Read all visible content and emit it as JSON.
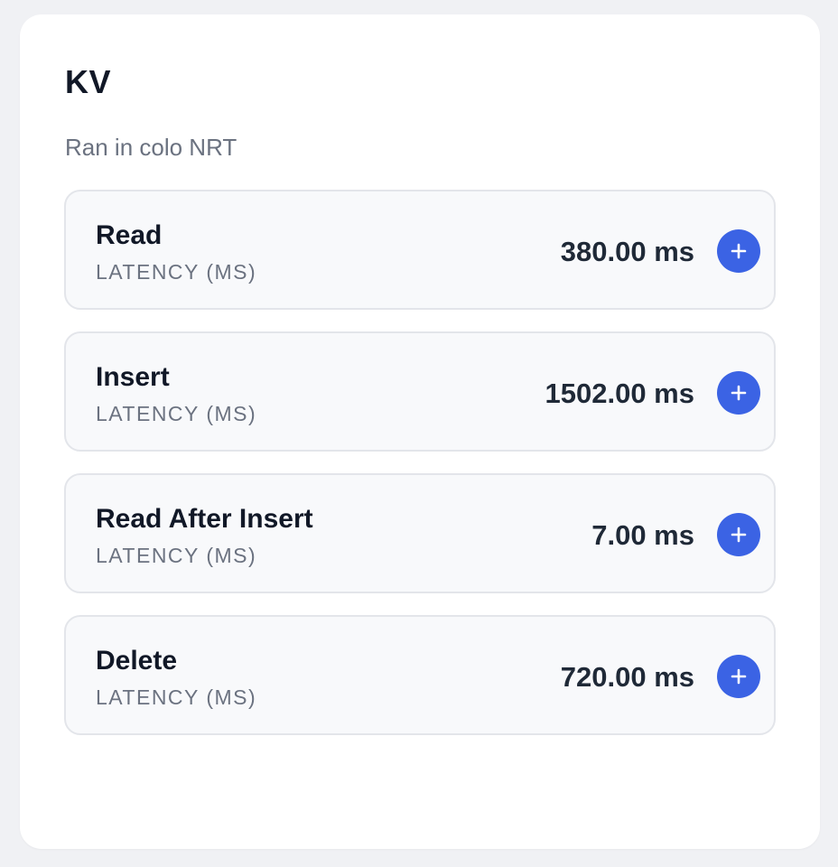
{
  "card": {
    "title": "KV",
    "subtitle": "Ran in colo NRT"
  },
  "metrics": [
    {
      "name": "Read",
      "sublabel": "LATENCY (MS)",
      "value": "380.00 ms",
      "button_icon": "plus-icon"
    },
    {
      "name": "Insert",
      "sublabel": "LATENCY (MS)",
      "value": "1502.00 ms",
      "button_icon": "plus-icon"
    },
    {
      "name": "Read After Insert",
      "sublabel": "LATENCY (MS)",
      "value": "7.00 ms",
      "button_icon": "plus-icon"
    },
    {
      "name": "Delete",
      "sublabel": "LATENCY (MS)",
      "value": "720.00 ms",
      "button_icon": "plus-icon"
    }
  ],
  "colors": {
    "accent": "#3b63e4",
    "page_bg": "#f0f1f4",
    "card_bg": "#ffffff",
    "row_bg": "#f8f9fb",
    "row_border": "#e3e5ea",
    "heading": "#111827",
    "muted": "#6b7280"
  }
}
